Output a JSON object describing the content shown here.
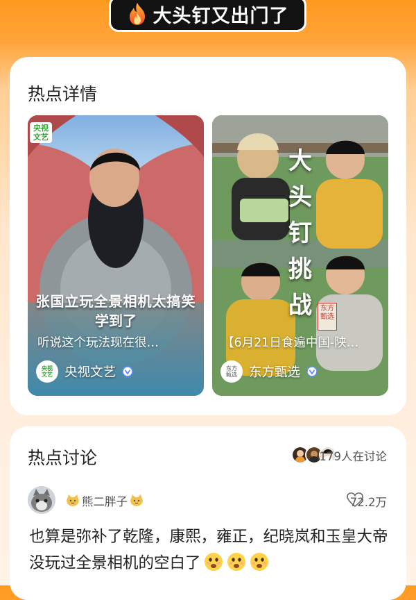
{
  "topic": {
    "title": "大头钉又出门了",
    "icon": "flame-icon"
  },
  "details": {
    "section_title": "热点详情",
    "videos": [
      {
        "overlay_line1": "张国立玩全景相机太搞笑",
        "overlay_line2": "学到了",
        "badge": "央视文艺",
        "title": "听说这个玩法现在很…",
        "author": "央视文艺",
        "verified_icon": "verified-icon"
      },
      {
        "vertical_text": "大头钉挑战",
        "stamp": "东方甄选",
        "title": "【6月21日食遍中国-陕…",
        "author": "东方甄选",
        "verified_icon": "verified-icon"
      }
    ]
  },
  "discussion": {
    "section_title": "热点讨论",
    "participants": "179人在讨论",
    "comment": {
      "username": "熊二胖子",
      "likes": "72.2万",
      "text": "也算是弥补了乾隆，康熙，雍正，纪晓岚和玉皇大帝没玩过全景相机的空白了"
    }
  },
  "colors": {
    "accent": "#ff9a1f",
    "verified": "#5b8bff",
    "card": "#ffffff"
  }
}
